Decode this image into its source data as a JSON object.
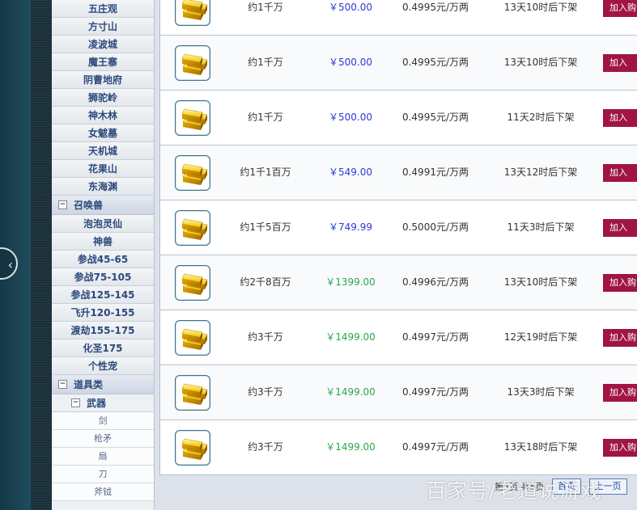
{
  "sidebar": {
    "group1_items": [
      "五庄观",
      "方寸山",
      "凌波城",
      "魔王寨",
      "阴曹地府",
      "狮驼岭",
      "神木林",
      "女魃墓",
      "天机城",
      "花果山",
      "东海渊"
    ],
    "summon": {
      "toggle": "−",
      "label": "召唤兽",
      "items": [
        "泡泡灵仙",
        "神兽",
        "参战45-65",
        "参战75-105",
        "参战125-145",
        "飞升120-155",
        "渡劫155-175",
        "化圣175",
        "个性宠"
      ]
    },
    "props": {
      "toggle": "−",
      "label": "道具类",
      "weapon": {
        "toggle": "−",
        "label": "武器",
        "items": [
          "剑",
          "枪矛",
          "扇",
          "刀",
          "斧钺"
        ]
      }
    }
  },
  "listings": [
    {
      "amount": "约1千万",
      "price": "￥500.00",
      "price_color": "blue",
      "unit": "0.4995元/万两",
      "time": "13天10时后下架",
      "button": "加入购"
    },
    {
      "amount": "约1千万",
      "price": "￥500.00",
      "price_color": "blue",
      "unit": "0.4995元/万两",
      "time": "13天10时后下架",
      "button": "加入"
    },
    {
      "amount": "约1千万",
      "price": "￥500.00",
      "price_color": "blue",
      "unit": "0.4995元/万两",
      "time": "11天2时后下架",
      "button": "加入"
    },
    {
      "amount": "约1千1百万",
      "price": "￥549.00",
      "price_color": "blue",
      "unit": "0.4991元/万两",
      "time": "13天12时后下架",
      "button": "加入"
    },
    {
      "amount": "约1千5百万",
      "price": "￥749.99",
      "price_color": "blue",
      "unit": "0.5000元/万两",
      "time": "11天3时后下架",
      "button": "加入"
    },
    {
      "amount": "约2千8百万",
      "price": "￥1399.00",
      "price_color": "green",
      "unit": "0.4996元/万两",
      "time": "13天10时后下架",
      "button": "加入购"
    },
    {
      "amount": "约3千万",
      "price": "￥1499.00",
      "price_color": "green",
      "unit": "0.4997元/万两",
      "time": "12天19时后下架",
      "button": "加入购"
    },
    {
      "amount": "约3千万",
      "price": "￥1499.00",
      "price_color": "green",
      "unit": "0.4997元/万两",
      "time": "13天3时后下架",
      "button": "加入购"
    },
    {
      "amount": "约3千万",
      "price": "￥1499.00",
      "price_color": "green",
      "unit": "0.4997元/万两",
      "time": "13天18时后下架",
      "button": "加入购"
    }
  ],
  "pager": {
    "info": "第5页 共5页",
    "first": "首页",
    "prev": "上一页"
  },
  "watermark": "百家号/老道说游戏",
  "colors": {
    "blue_price": "#2b3ad6",
    "green_price": "#2aa84a",
    "add_button": "#a01544"
  },
  "icons": {
    "gold": "gold-bar-icon",
    "nav": "chevron-left-icon"
  },
  "nav_glyph": "‹"
}
